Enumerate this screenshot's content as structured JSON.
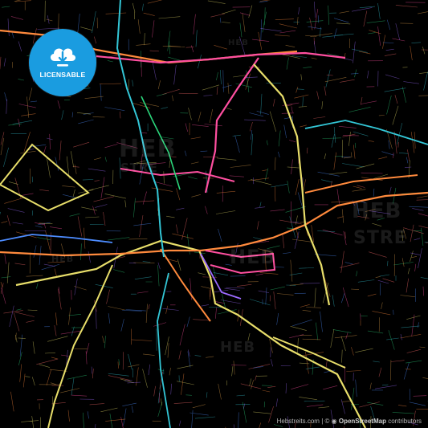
{
  "badge": {
    "label": "LICENSABLE",
    "color": "#1a9ce0",
    "icon": "cloud-download-icon"
  },
  "watermark": {
    "brand": "HEB",
    "brand_sub": "STRE",
    "color": "rgba(255,255,255,0.10)"
  },
  "attribution": {
    "site": "Hebstreits.com",
    "separator": " | © ",
    "osm": "OpenStreetMap",
    "contributors": " contributors",
    "osm_icon": "osm-icon"
  },
  "colors": {
    "background": "#000000",
    "road_palette": [
      "#e8de6a",
      "#ff8a3d",
      "#ff4fa0",
      "#33c6d6",
      "#4d8cff",
      "#9c6bff",
      "#2bd67b",
      "#ff6b6b",
      "#e4a24a"
    ],
    "major_yellow": "#e8de6a",
    "major_orange": "#ff8a3d",
    "major_pink": "#ff4fa0",
    "major_cyan": "#33c6d6",
    "major_blue": "#4d8cff",
    "major_purple": "#9c6bff",
    "major_green": "#2bd67b"
  }
}
